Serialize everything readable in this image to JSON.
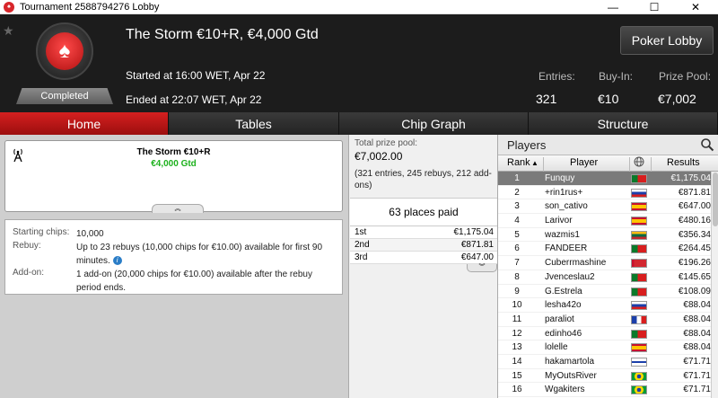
{
  "window": {
    "title": "Tournament 2588794276 Lobby",
    "minimize": "—",
    "maximize": "☐",
    "close": "✕"
  },
  "header": {
    "status_badge": "Completed",
    "tournament_name": "The Storm €10+R, €4,000 Gtd",
    "started": "Started at 16:00 WET, Apr 22",
    "ended": "Ended at 22:07 WET, Apr 22",
    "lobby_button": "Poker Lobby",
    "stats": {
      "entries_label": "Entries:",
      "entries_value": "321",
      "buyin_label": "Buy-In:",
      "buyin_value": "€10",
      "prizepool_label": "Prize Pool:",
      "prizepool_value": "€7,002"
    }
  },
  "tabs": [
    {
      "label": "Home",
      "active": true
    },
    {
      "label": "Tables",
      "active": false
    },
    {
      "label": "Chip Graph",
      "active": false
    },
    {
      "label": "Structure",
      "active": false
    }
  ],
  "home": {
    "card_name": "The Storm €10+R",
    "card_guarantee": "€4,000 Gtd",
    "info": [
      {
        "key": "Starting chips:",
        "value": "10,000"
      },
      {
        "key": "Rebuy:",
        "value": "Up to 23 rebuys (10,000 chips for €10.00) available for first 90 minutes."
      },
      {
        "key": "Add-on:",
        "value": "1 add-on (20,000 chips for €10.00) available after the rebuy period ends."
      }
    ]
  },
  "prizes": {
    "total_label": "Total prize pool:",
    "total_value": "€7,002.00",
    "description": "(321 entries, 245 rebuys, 212 add-ons)",
    "places_paid": "63 places paid",
    "rows": [
      {
        "place": "1st",
        "amount": "€1,175.04"
      },
      {
        "place": "2nd",
        "amount": "€871.81"
      },
      {
        "place": "3rd",
        "amount": "€647.00"
      }
    ]
  },
  "players": {
    "title": "Players",
    "columns": {
      "rank": "Rank",
      "player": "Player",
      "results": "Results"
    },
    "rows": [
      {
        "rank": "1",
        "name": "Funquy",
        "flag": "pt",
        "result": "€1,175.04"
      },
      {
        "rank": "2",
        "name": "+rin1rus+",
        "flag": "ru",
        "result": "€871.81"
      },
      {
        "rank": "3",
        "name": "son_cativo",
        "flag": "es",
        "result": "€647.00"
      },
      {
        "rank": "4",
        "name": "Larivor",
        "flag": "es",
        "result": "€480.16"
      },
      {
        "rank": "5",
        "name": "wazmis1",
        "flag": "lt",
        "result": "€356.34"
      },
      {
        "rank": "6",
        "name": "FANDEER",
        "flag": "pt",
        "result": "€264.45"
      },
      {
        "rank": "7",
        "name": "Cuberrmashine",
        "flag": "by",
        "result": "€196.26"
      },
      {
        "rank": "8",
        "name": "Jvenceslau2",
        "flag": "pt",
        "result": "€145.65"
      },
      {
        "rank": "9",
        "name": "G.Estrela",
        "flag": "pt",
        "result": "€108.09"
      },
      {
        "rank": "10",
        "name": "lesha42o",
        "flag": "ru",
        "result": "€88.04"
      },
      {
        "rank": "11",
        "name": "paraliot",
        "flag": "fr",
        "result": "€88.04"
      },
      {
        "rank": "12",
        "name": "edinho46",
        "flag": "pt",
        "result": "€88.04"
      },
      {
        "rank": "13",
        "name": "lolelle",
        "flag": "es",
        "result": "€88.04"
      },
      {
        "rank": "14",
        "name": "hakamartola",
        "flag": "fi",
        "result": "€71.71"
      },
      {
        "rank": "15",
        "name": "MyOutsRiver",
        "flag": "br",
        "result": "€71.71"
      },
      {
        "rank": "16",
        "name": "Wgakiters",
        "flag": "br",
        "result": "€71.71"
      }
    ]
  },
  "colors": {
    "accent_red": "#d52020",
    "guarantee_green": "#1db11d",
    "header_bg": "#1c1c1c"
  }
}
